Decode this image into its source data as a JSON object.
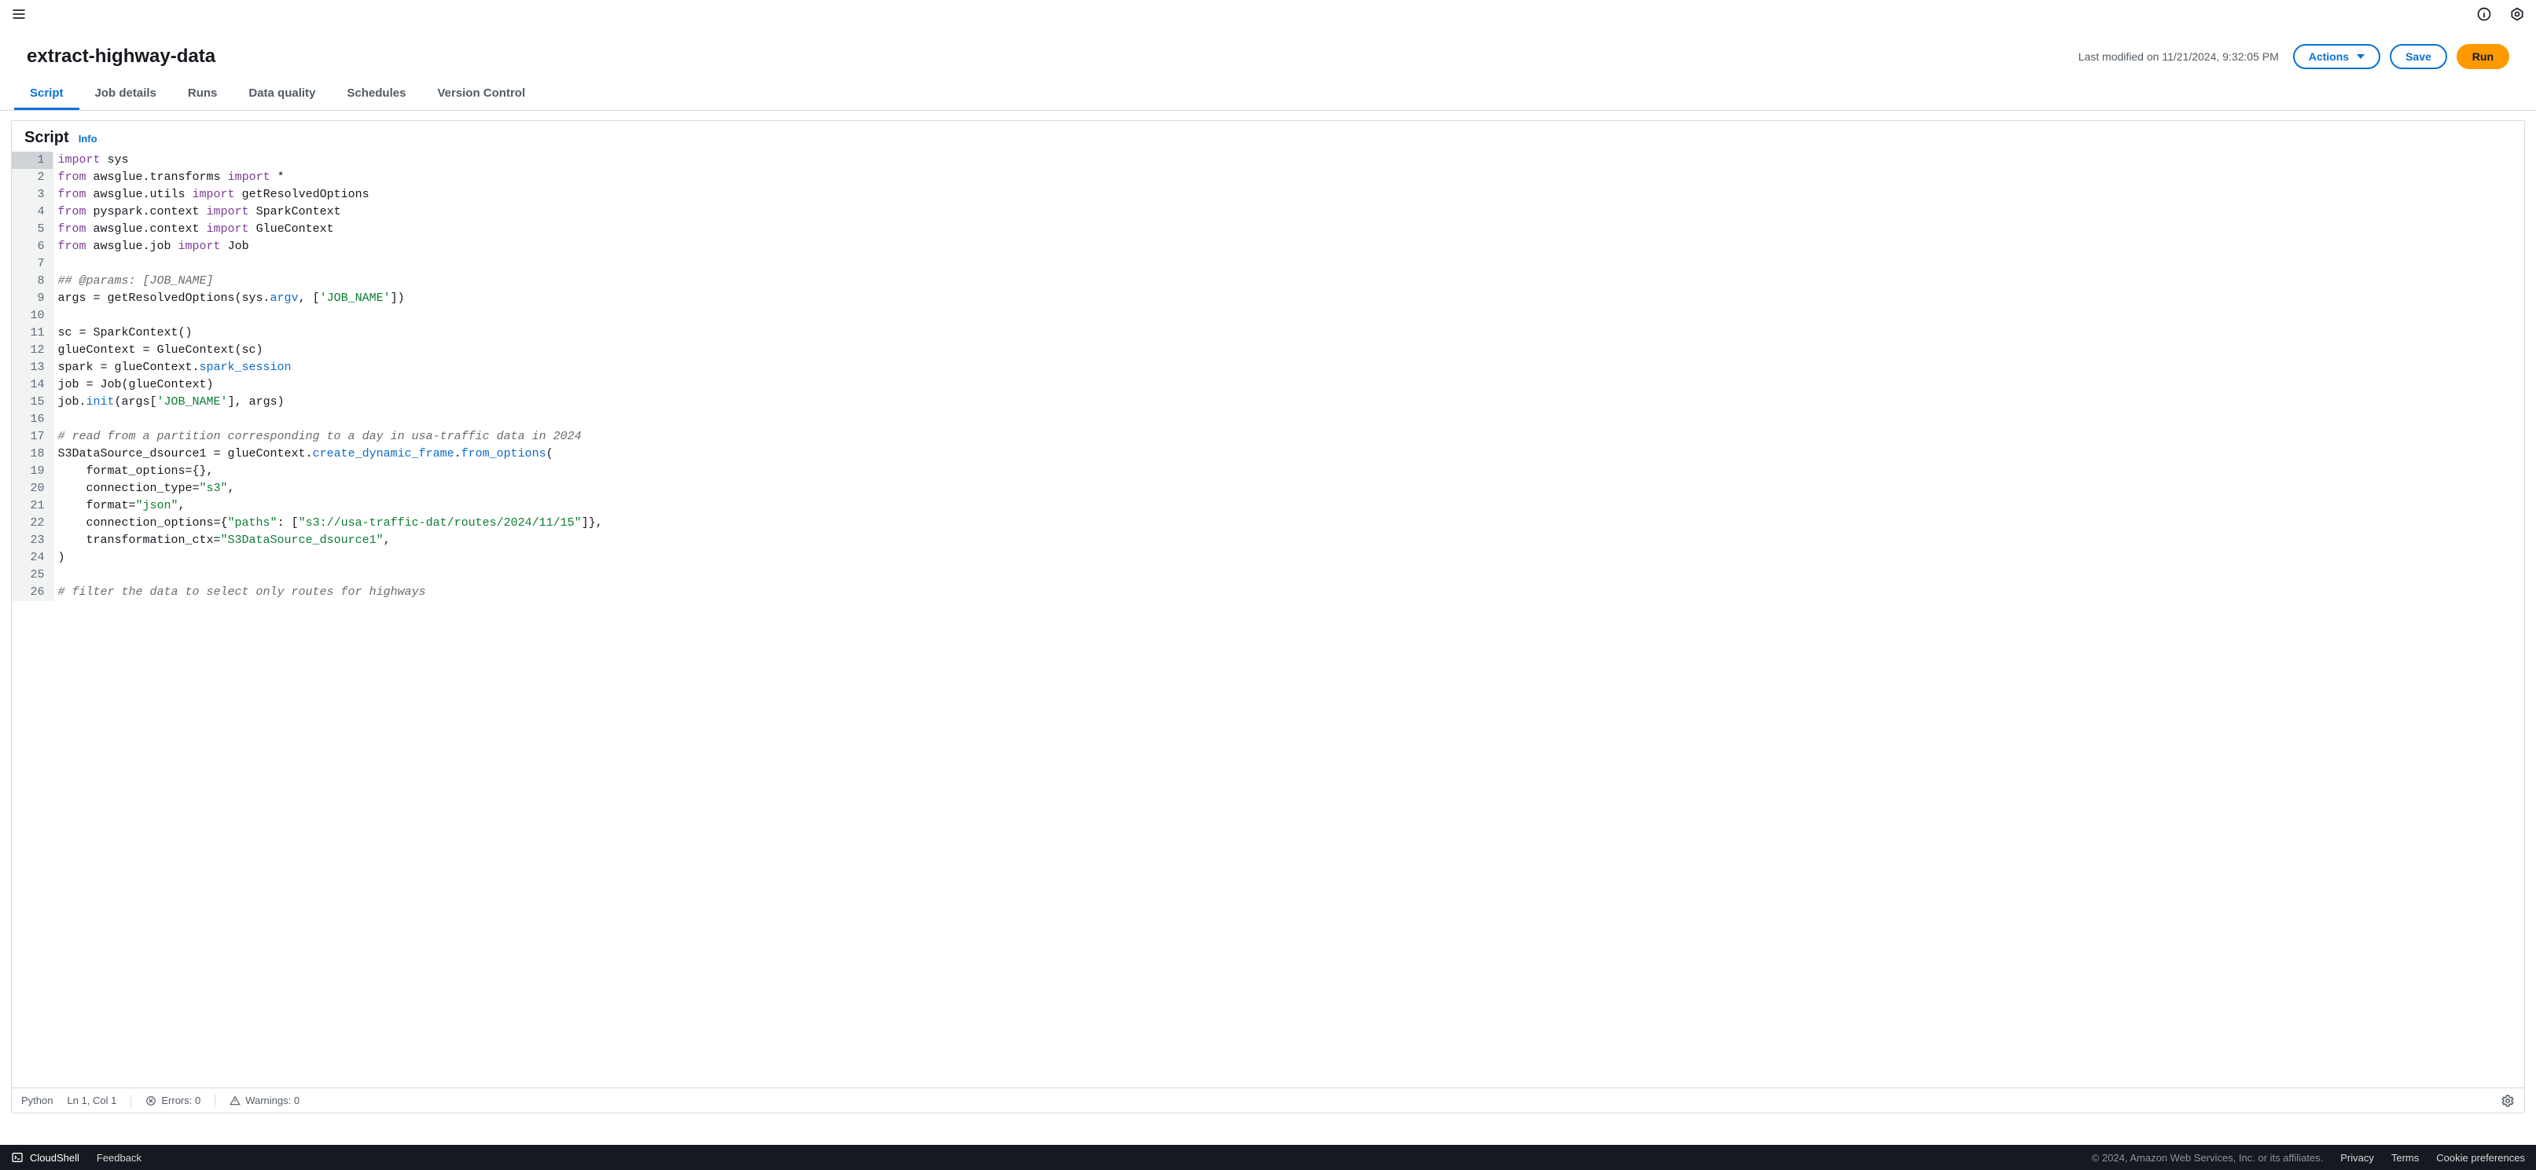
{
  "header": {
    "job_title": "extract-highway-data",
    "last_modified": "Last modified on 11/21/2024, 9:32:05 PM",
    "actions_label": "Actions",
    "save_label": "Save",
    "run_label": "Run"
  },
  "tabs": {
    "script": "Script",
    "job_details": "Job details",
    "runs": "Runs",
    "data_quality": "Data quality",
    "schedules": "Schedules",
    "version_control": "Version Control"
  },
  "panel": {
    "title": "Script",
    "info": "Info"
  },
  "code": {
    "lines": [
      [
        [
          "kw",
          "import"
        ],
        [
          "",
          " sys"
        ]
      ],
      [
        [
          "kw",
          "from"
        ],
        [
          "",
          " awsglue"
        ],
        [
          "",
          ".transforms "
        ],
        [
          "kw",
          "import"
        ],
        [
          "",
          " *"
        ]
      ],
      [
        [
          "kw",
          "from"
        ],
        [
          "",
          " awsglue"
        ],
        [
          "",
          ".utils "
        ],
        [
          "kw",
          "import"
        ],
        [
          "",
          " getResolvedOptions"
        ]
      ],
      [
        [
          "kw",
          "from"
        ],
        [
          "",
          " pyspark"
        ],
        [
          "",
          ".context "
        ],
        [
          "kw",
          "import"
        ],
        [
          "",
          " SparkContext"
        ]
      ],
      [
        [
          "kw",
          "from"
        ],
        [
          "",
          " awsglue"
        ],
        [
          "",
          ".context "
        ],
        [
          "kw",
          "import"
        ],
        [
          "",
          " GlueContext"
        ]
      ],
      [
        [
          "kw",
          "from"
        ],
        [
          "",
          " awsglue"
        ],
        [
          "",
          ".job "
        ],
        [
          "kw",
          "import"
        ],
        [
          "",
          " Job"
        ]
      ],
      [
        [
          "",
          ""
        ]
      ],
      [
        [
          "com",
          "## @params: [JOB_NAME]"
        ]
      ],
      [
        [
          "",
          "args = getResolvedOptions(sys."
        ],
        [
          "attr",
          "argv"
        ],
        [
          "",
          ", ["
        ],
        [
          "str",
          "'JOB_NAME'"
        ],
        [
          "",
          "])"
        ]
      ],
      [
        [
          "",
          ""
        ]
      ],
      [
        [
          "",
          "sc = SparkContext()"
        ]
      ],
      [
        [
          "",
          "glueContext = GlueContext(sc)"
        ]
      ],
      [
        [
          "",
          "spark = glueContext."
        ],
        [
          "attr",
          "spark_session"
        ]
      ],
      [
        [
          "",
          "job = Job(glueContext)"
        ]
      ],
      [
        [
          "",
          "job."
        ],
        [
          "attr",
          "init"
        ],
        [
          "",
          "(args["
        ],
        [
          "str",
          "'JOB_NAME'"
        ],
        [
          "",
          "], args)"
        ]
      ],
      [
        [
          "",
          ""
        ]
      ],
      [
        [
          "com",
          "# read from a partition corresponding to a day in usa-traffic data in 2024"
        ]
      ],
      [
        [
          "",
          "S3DataSource_dsource1 = glueContext."
        ],
        [
          "attr",
          "create_dynamic_frame"
        ],
        [
          "",
          "."
        ],
        [
          "attr",
          "from_options"
        ],
        [
          "",
          "("
        ]
      ],
      [
        [
          "",
          "    format_options={},"
        ]
      ],
      [
        [
          "",
          "    connection_type="
        ],
        [
          "str",
          "\"s3\""
        ],
        [
          "",
          ","
        ]
      ],
      [
        [
          "",
          "    format="
        ],
        [
          "str",
          "\"json\""
        ],
        [
          "",
          ","
        ]
      ],
      [
        [
          "",
          "    connection_options={"
        ],
        [
          "str",
          "\"paths\""
        ],
        [
          "",
          ": ["
        ],
        [
          "str",
          "\"s3://usa-traffic-dat/routes/2024/11/15\""
        ],
        [
          "",
          "]},"
        ]
      ],
      [
        [
          "",
          "    transformation_ctx="
        ],
        [
          "str",
          "\"S3DataSource_dsource1\""
        ],
        [
          "",
          ","
        ]
      ],
      [
        [
          "",
          ")"
        ]
      ],
      [
        [
          "",
          ""
        ]
      ],
      [
        [
          "com",
          "# filter the data to select only routes for highways"
        ]
      ]
    ]
  },
  "statusbar": {
    "language": "Python",
    "cursor": "Ln 1, Col 1",
    "errors": "Errors: 0",
    "warnings": "Warnings: 0"
  },
  "bottombar": {
    "cloudshell": "CloudShell",
    "feedback": "Feedback",
    "copyright": "© 2024, Amazon Web Services, Inc. or its affiliates.",
    "privacy": "Privacy",
    "terms": "Terms",
    "cookies": "Cookie preferences"
  }
}
